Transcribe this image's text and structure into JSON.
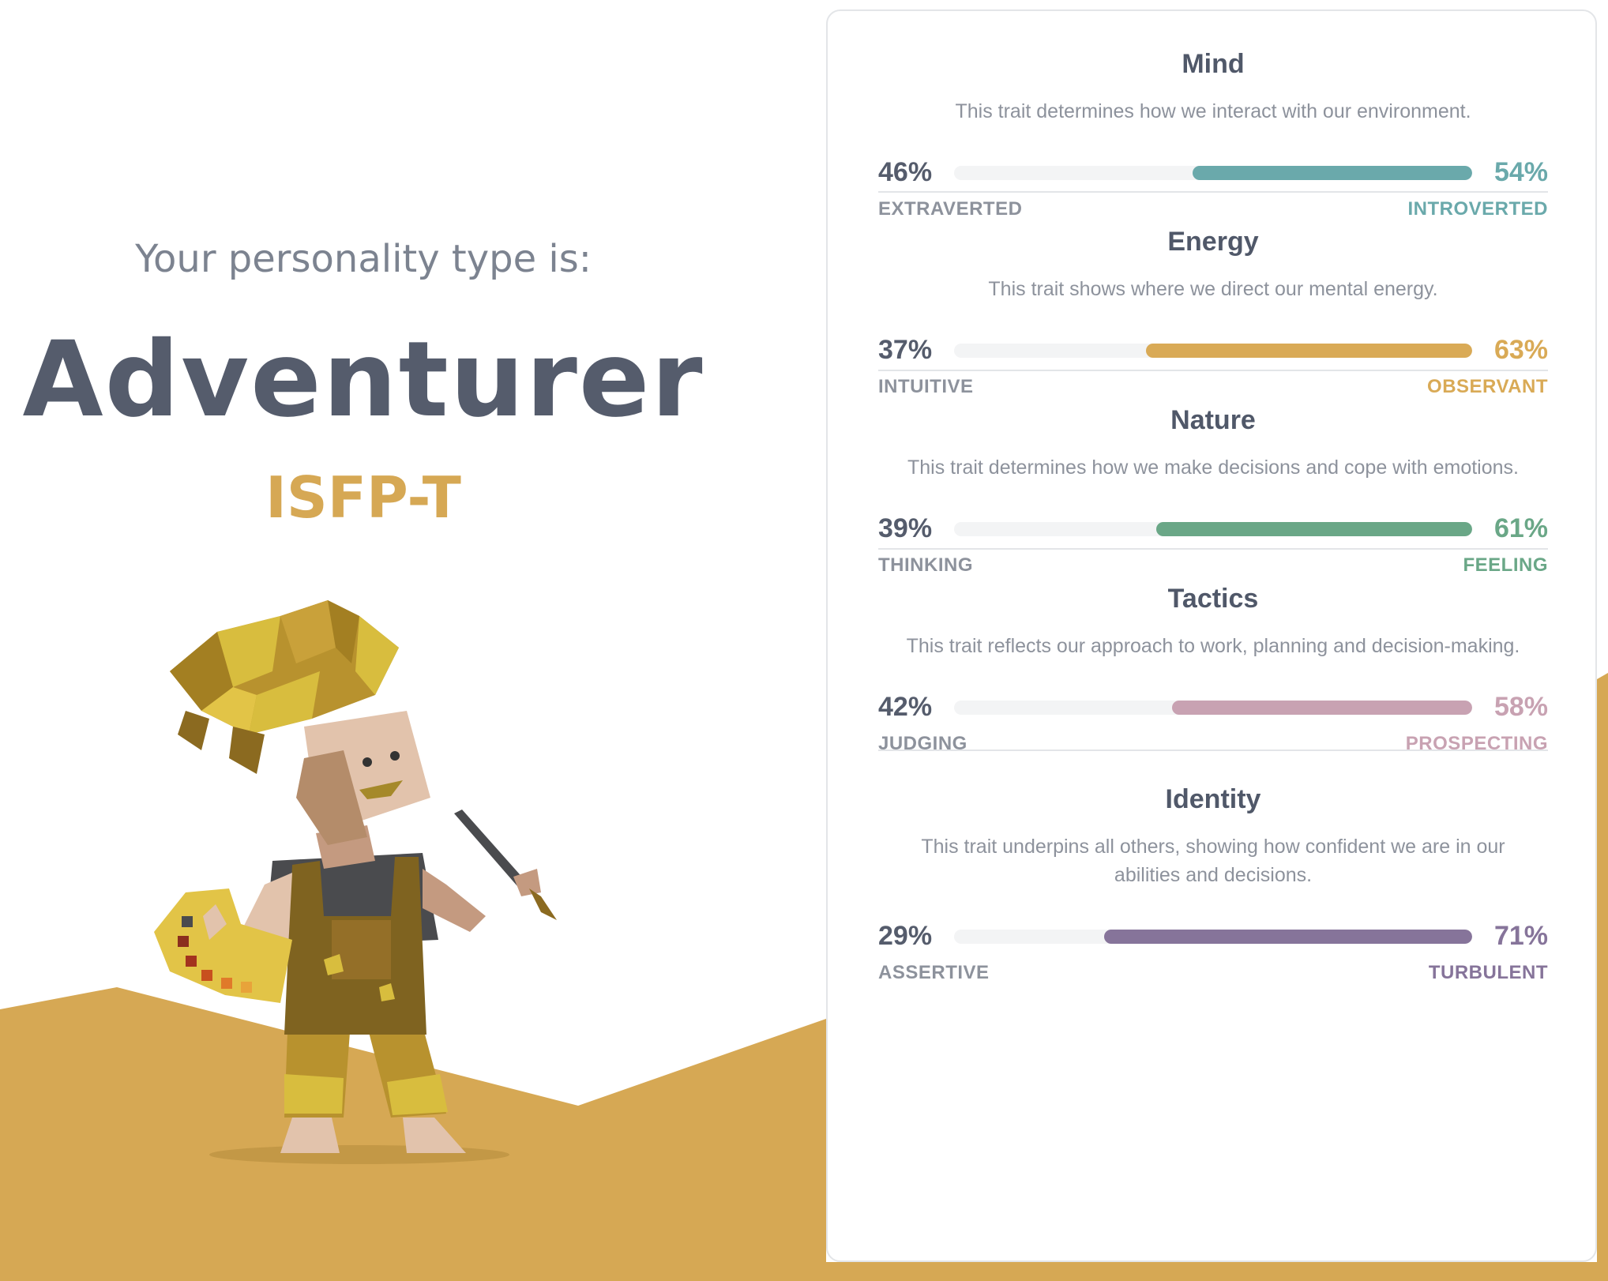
{
  "intro": "Your personality type is:",
  "type_name": "Adventurer",
  "type_code": "ISFP-T",
  "colors": {
    "accent": "#d6a854",
    "heading": "#555c6c",
    "mind": "#6aa9ab",
    "energy": "#d9aa56",
    "nature": "#6aa787",
    "tactics": "#c8a2b2",
    "identity": "#86749a"
  },
  "traits": [
    {
      "title": "Mind",
      "description": "This trait determines how we interact with our environment.",
      "left_pct": "46%",
      "right_pct": "54%",
      "left_label": "EXTRAVERTED",
      "right_label": "INTROVERTED",
      "fill_fraction": 0.54,
      "color": "#6aa9ab"
    },
    {
      "title": "Energy",
      "description": "This trait shows where we direct our mental energy.",
      "left_pct": "37%",
      "right_pct": "63%",
      "left_label": "INTUITIVE",
      "right_label": "OBSERVANT",
      "fill_fraction": 0.63,
      "color": "#d9aa56"
    },
    {
      "title": "Nature",
      "description": "This trait determines how we make decisions and cope with emotions.",
      "left_pct": "39%",
      "right_pct": "61%",
      "left_label": "THINKING",
      "right_label": "FEELING",
      "fill_fraction": 0.61,
      "color": "#6aa787"
    },
    {
      "title": "Tactics",
      "description": "This trait reflects our approach to work, planning and decision-making.",
      "left_pct": "42%",
      "right_pct": "58%",
      "left_label": "JUDGING",
      "right_label": "PROSPECTING",
      "fill_fraction": 0.58,
      "color": "#c8a2b2"
    },
    {
      "title": "Identity",
      "description": "This trait underpins all others, showing how confident we are in our abilities and decisions.",
      "left_pct": "29%",
      "right_pct": "71%",
      "left_label": "ASSERTIVE",
      "right_label": "TURBULENT",
      "fill_fraction": 0.71,
      "color": "#86749a"
    }
  ]
}
